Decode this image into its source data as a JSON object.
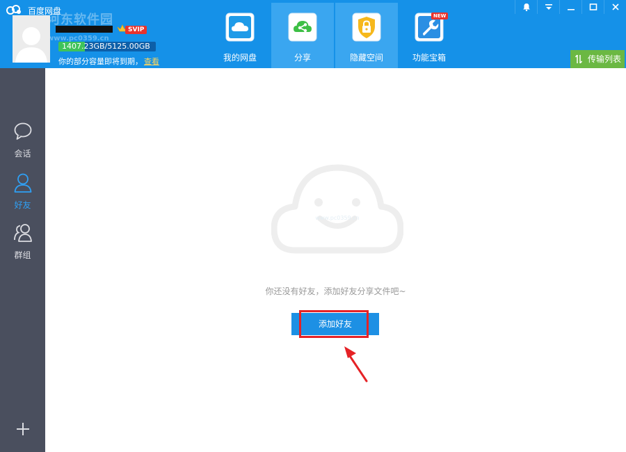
{
  "app": {
    "title": "百度网盘"
  },
  "watermark": {
    "text": "河东软件园",
    "sub": "www.pc0359.cn"
  },
  "user": {
    "svip_label": "SVIP",
    "quota_text": "1407.23GB/5125.00GB",
    "quota_fraction": 0.2746,
    "expire_note": "你的部分容量即将到期，",
    "expire_link": "查看"
  },
  "nav": {
    "tabs": [
      {
        "label": "我的网盘",
        "icon": "cloud-drive-icon"
      },
      {
        "label": "分享",
        "icon": "share-icon"
      },
      {
        "label": "隐藏空间",
        "icon": "lock-shield-icon"
      },
      {
        "label": "功能宝箱",
        "icon": "wrench-toolbox-icon",
        "badge": "NEW"
      }
    ],
    "active_tab": "分享"
  },
  "toolbar": {
    "transfer_label": "传输列表"
  },
  "sidebar": {
    "items": [
      {
        "label": "会话",
        "icon": "chat-bubble-icon"
      },
      {
        "label": "好友",
        "icon": "friend-icon"
      },
      {
        "label": "群组",
        "icon": "group-icon"
      }
    ],
    "active_item": "好友"
  },
  "main": {
    "empty_text": "你还没有好友，添加好友分享文件吧~",
    "empty_watermark": "www.pc0359.cn",
    "add_friend_label": "添加好友"
  },
  "colors": {
    "titlebar": "#1591e8",
    "sidebar": "#4a4f5e",
    "accent": "#1d90e4",
    "highlight": "#e52226",
    "transfer": "#6bb843"
  }
}
